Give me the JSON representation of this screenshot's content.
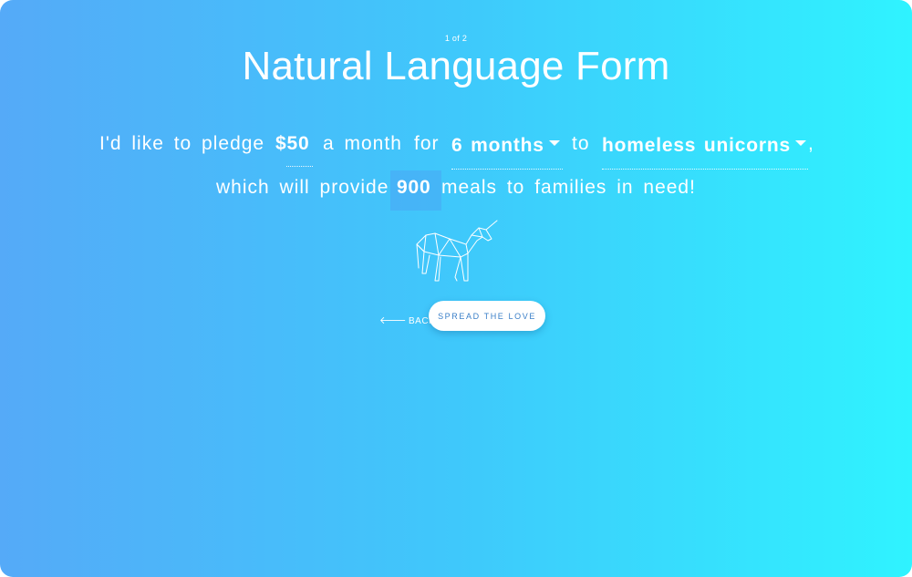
{
  "form": {
    "step": "1 of 2",
    "title": "Natural Language Form",
    "sentence": {
      "part1": "I'd like to pledge",
      "amount": "$50",
      "part2": "a month",
      "part3": "for",
      "duration": "6 months",
      "part4": "to",
      "cause": "homeless unicorns",
      "punct": ",",
      "part5": "which will provide",
      "meals": "900",
      "part6": "meals to families in need!"
    },
    "actions": {
      "back_label": "BACK",
      "submit_label": "SPREAD THE LOVE"
    },
    "illustration": "unicorn-line-art"
  },
  "colors": {
    "gradient_start": "#55aaf8",
    "gradient_end": "#2ff3ff",
    "button_text": "#3a7fc8"
  }
}
